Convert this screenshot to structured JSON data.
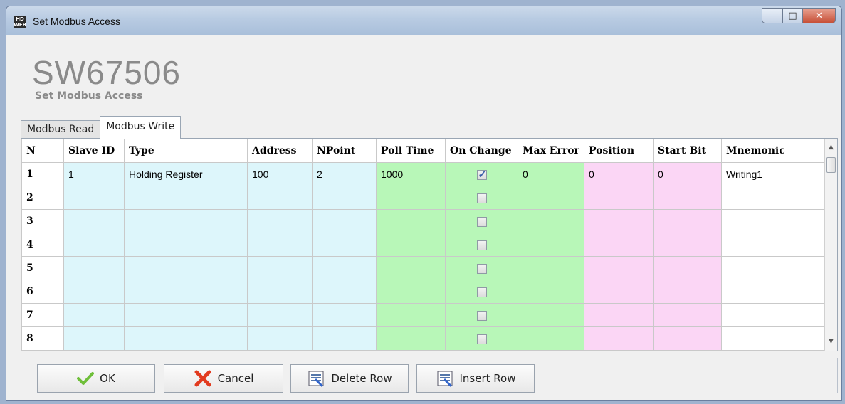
{
  "window": {
    "title": "Set Modbus Access",
    "icon_text": "HD\nWEB"
  },
  "header": {
    "title": "SW67506",
    "subtitle": "Set Modbus Access"
  },
  "tabs": [
    {
      "label": "Modbus Read",
      "active": false
    },
    {
      "label": "Modbus Write",
      "active": true
    }
  ],
  "grid": {
    "columns": [
      "N",
      "Slave ID",
      "Type",
      "Address",
      "NPoint",
      "Poll Time",
      "On Change",
      "Max Error",
      "Position",
      "Start Bit",
      "Mnemonic"
    ],
    "rows": [
      {
        "n": "1",
        "slave_id": "1",
        "type": "Holding Register",
        "address": "100",
        "npoint": "2",
        "poll_time": "1000",
        "on_change": true,
        "max_error": "0",
        "position": "0",
        "start_bit": "0",
        "mnemonic": "Writing1"
      },
      {
        "n": "2",
        "slave_id": "",
        "type": "",
        "address": "",
        "npoint": "",
        "poll_time": "",
        "on_change": false,
        "max_error": "",
        "position": "",
        "start_bit": "",
        "mnemonic": ""
      },
      {
        "n": "3",
        "slave_id": "",
        "type": "",
        "address": "",
        "npoint": "",
        "poll_time": "",
        "on_change": false,
        "max_error": "",
        "position": "",
        "start_bit": "",
        "mnemonic": ""
      },
      {
        "n": "4",
        "slave_id": "",
        "type": "",
        "address": "",
        "npoint": "",
        "poll_time": "",
        "on_change": false,
        "max_error": "",
        "position": "",
        "start_bit": "",
        "mnemonic": ""
      },
      {
        "n": "5",
        "slave_id": "",
        "type": "",
        "address": "",
        "npoint": "",
        "poll_time": "",
        "on_change": false,
        "max_error": "",
        "position": "",
        "start_bit": "",
        "mnemonic": ""
      },
      {
        "n": "6",
        "slave_id": "",
        "type": "",
        "address": "",
        "npoint": "",
        "poll_time": "",
        "on_change": false,
        "max_error": "",
        "position": "",
        "start_bit": "",
        "mnemonic": ""
      },
      {
        "n": "7",
        "slave_id": "",
        "type": "",
        "address": "",
        "npoint": "",
        "poll_time": "",
        "on_change": false,
        "max_error": "",
        "position": "",
        "start_bit": "",
        "mnemonic": ""
      },
      {
        "n": "8",
        "slave_id": "",
        "type": "",
        "address": "",
        "npoint": "",
        "poll_time": "",
        "on_change": false,
        "max_error": "",
        "position": "",
        "start_bit": "",
        "mnemonic": ""
      }
    ]
  },
  "buttons": {
    "ok": "OK",
    "cancel": "Cancel",
    "delete_row": "Delete Row",
    "insert_row": "Insert Row"
  },
  "colors": {
    "blue_cells": "#ddf6fb",
    "green_cells": "#b8f7b8",
    "pink_cells": "#fbd6f5",
    "title_gray": "#8a8a8a"
  },
  "icons": {
    "ok": "checkmark-icon",
    "cancel": "red-x-icon",
    "delete_row": "delete-row-icon",
    "insert_row": "insert-row-icon"
  }
}
